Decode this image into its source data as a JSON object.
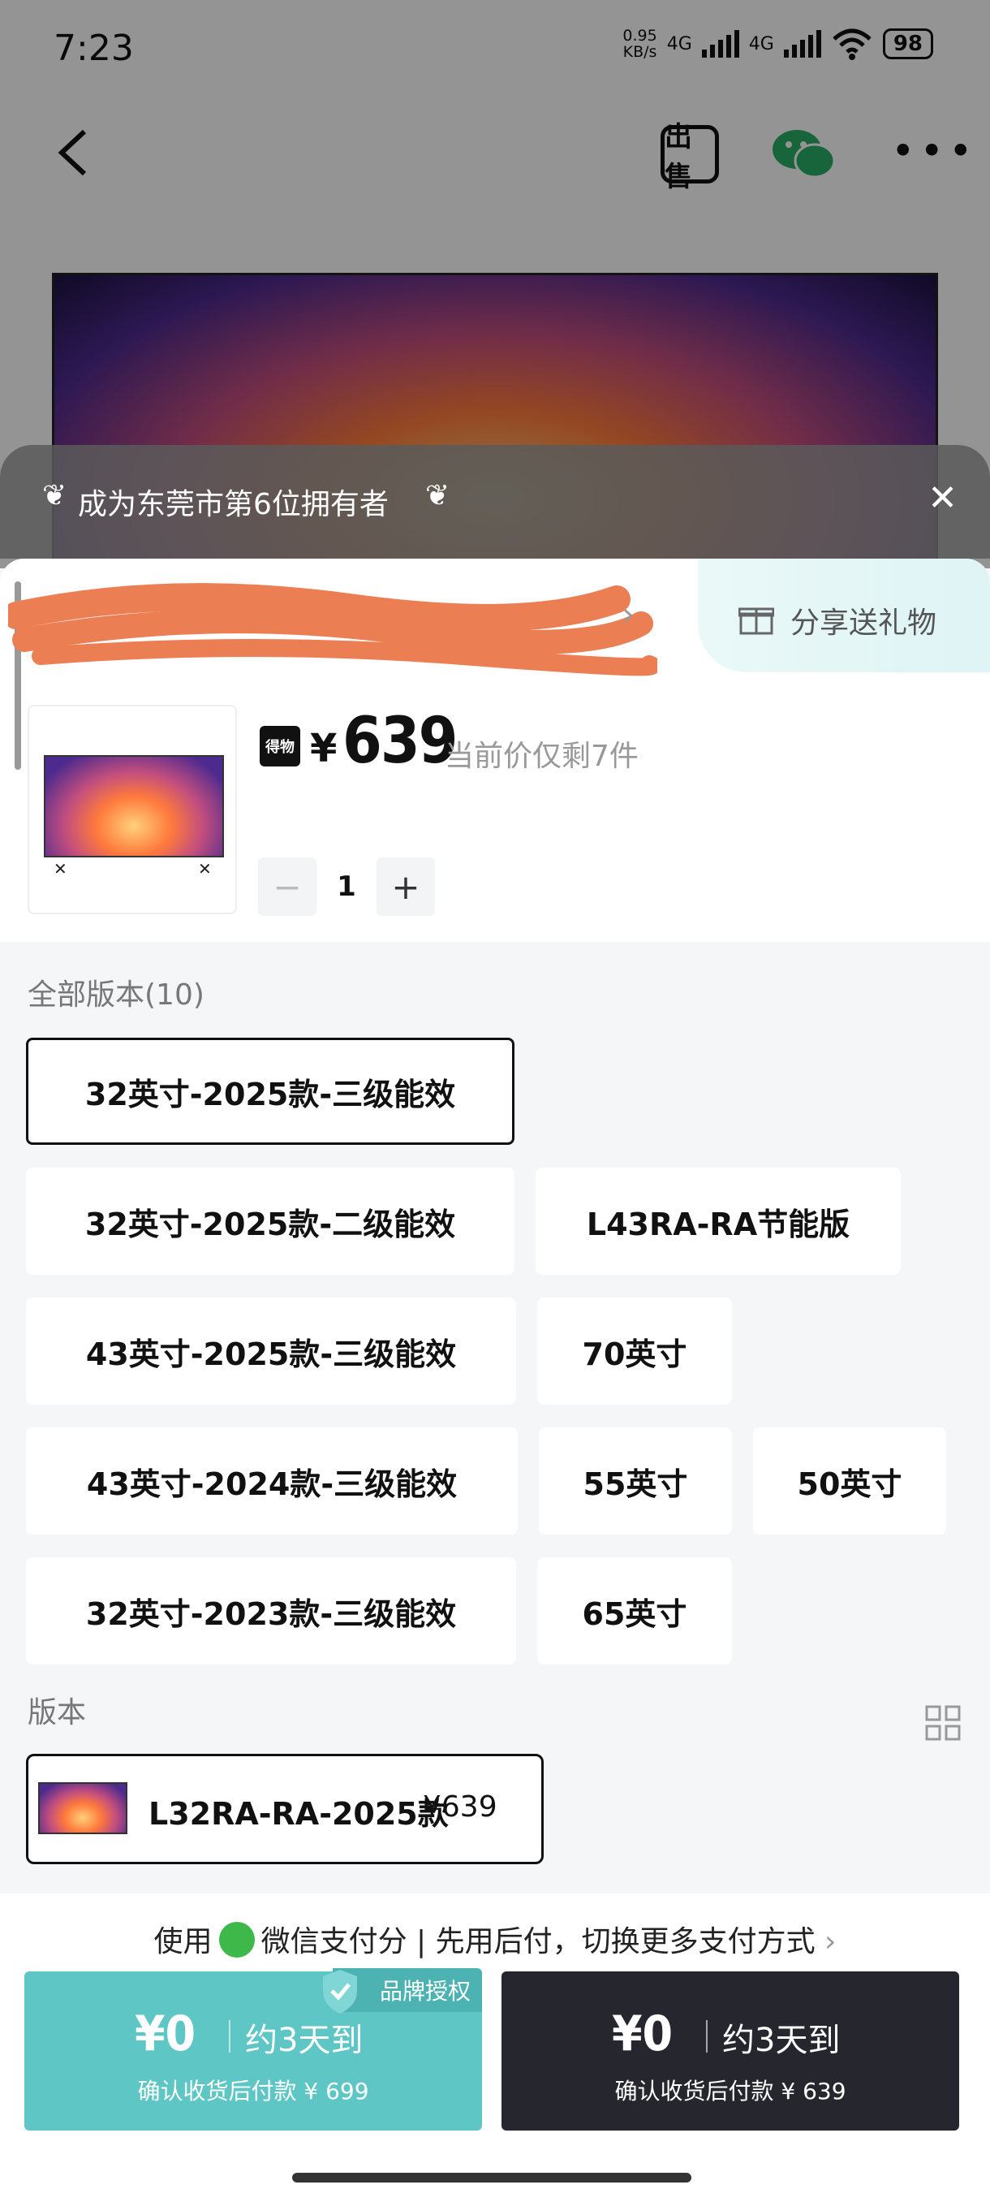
{
  "status": {
    "time": "7:23",
    "speed_value": "0.95",
    "speed_unit": "KB/s",
    "net1": "4G",
    "net2": "4G",
    "battery": "98"
  },
  "nav": {
    "sell_label": "出售"
  },
  "owner_banner": {
    "text": "成为东莞市第6位拥有者"
  },
  "share": {
    "label": "分享送礼物"
  },
  "product": {
    "brand_badge": "得物",
    "currency": "¥",
    "price": "639",
    "stock_note": "当前价仅剩7件",
    "quantity": "1"
  },
  "versions_all": {
    "label": "全部版本(10)",
    "options": [
      "32英寸-2025款-三级能效",
      "32英寸-2025款-二级能效",
      "L43RA-RA节能版",
      "43英寸-2025款-三级能效",
      "70英寸",
      "43英寸-2024款-三级能效",
      "55英寸",
      "50英寸",
      "32英寸-2023款-三级能效",
      "65英寸"
    ],
    "selected": "32英寸-2025款-三级能效"
  },
  "version": {
    "label": "版本",
    "name": "L32RA-RA-2025款",
    "price": "¥639"
  },
  "payment": {
    "prefix": "使用",
    "method": "微信支付分 | 先用后付，切换更多支付方式",
    "teal_button": {
      "amount": "¥0",
      "eta": "约3天到",
      "sub": "确认收货后付款 ¥ 699",
      "badge": "品牌授权"
    },
    "dark_button": {
      "amount": "¥0",
      "eta": "约3天到",
      "sub": "确认收货后付款 ¥ 639"
    }
  },
  "colors": {
    "teal": "#5ec6c5",
    "dark": "#26262e",
    "accent_text": "#111111"
  }
}
